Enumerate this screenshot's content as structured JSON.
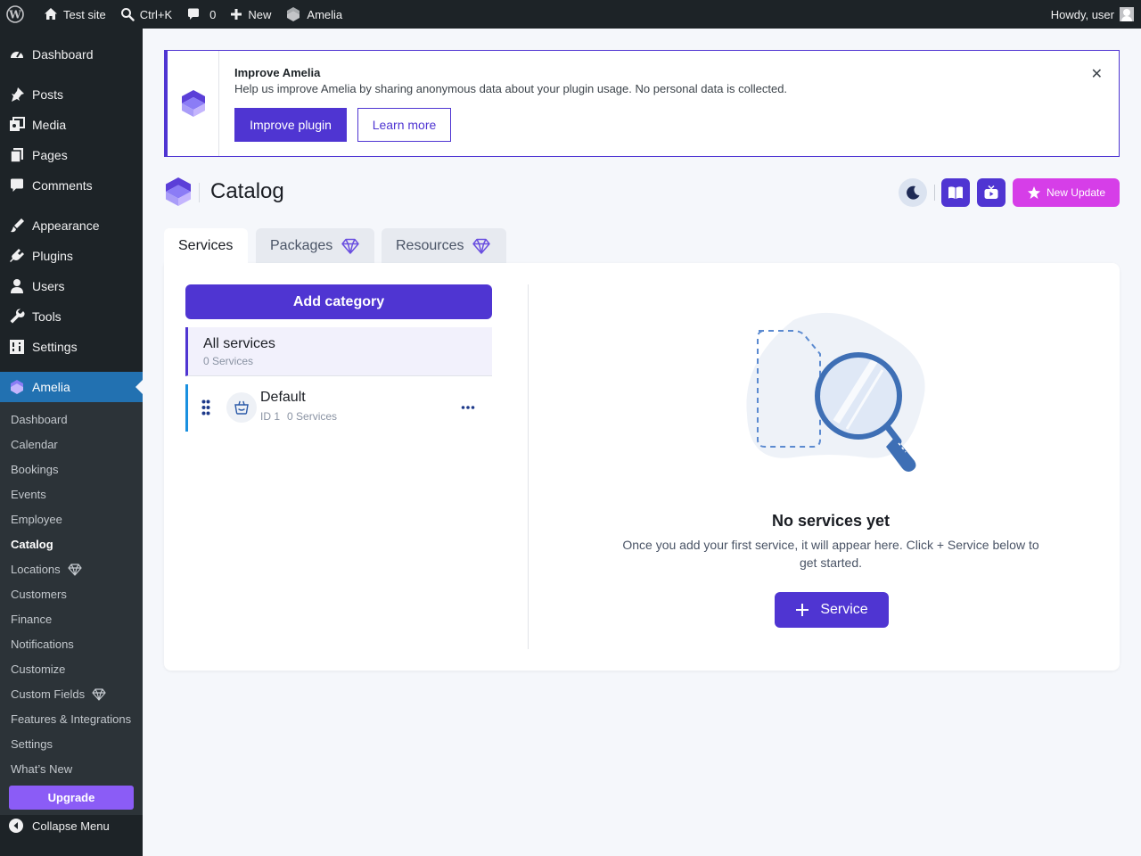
{
  "adminbar": {
    "site_name": "Test site",
    "search_shortcut": "Ctrl+K",
    "comments_count": "0",
    "new_label": "New",
    "plugin_label": "Amelia",
    "greeting": "Howdy, user"
  },
  "sidebar": {
    "menu": [
      {
        "label": "Dashboard",
        "icon": "dashboard-icon"
      },
      {
        "label": "Posts",
        "icon": "pin-icon"
      },
      {
        "label": "Media",
        "icon": "media-icon"
      },
      {
        "label": "Pages",
        "icon": "pages-icon"
      },
      {
        "label": "Comments",
        "icon": "comment-icon"
      },
      {
        "label": "Appearance",
        "icon": "brush-icon"
      },
      {
        "label": "Plugins",
        "icon": "plug-icon"
      },
      {
        "label": "Users",
        "icon": "user-icon"
      },
      {
        "label": "Tools",
        "icon": "wrench-icon"
      },
      {
        "label": "Settings",
        "icon": "settings-icon"
      },
      {
        "label": "Amelia",
        "icon": "amelia-logo-icon"
      }
    ],
    "submenu": [
      {
        "label": "Dashboard"
      },
      {
        "label": "Calendar"
      },
      {
        "label": "Bookings"
      },
      {
        "label": "Events"
      },
      {
        "label": "Employee"
      },
      {
        "label": "Catalog",
        "current": true
      },
      {
        "label": "Locations",
        "premium": true
      },
      {
        "label": "Customers"
      },
      {
        "label": "Finance"
      },
      {
        "label": "Notifications"
      },
      {
        "label": "Customize"
      },
      {
        "label": "Custom Fields",
        "premium": true
      },
      {
        "label": "Features & Integrations"
      },
      {
        "label": "Settings"
      },
      {
        "label": "What’s New"
      }
    ],
    "upgrade_label": "Upgrade",
    "collapse_label": "Collapse Menu"
  },
  "notice": {
    "title": "Improve Amelia",
    "text": "Help us improve Amelia by sharing anonymous data about your plugin usage. No personal data is collected.",
    "primary_button": "Improve plugin",
    "secondary_button": "Learn more"
  },
  "page": {
    "title": "Catalog",
    "new_update_label": "New Update"
  },
  "tabs": [
    {
      "label": "Services",
      "active": true
    },
    {
      "label": "Packages",
      "premium": true
    },
    {
      "label": "Resources",
      "premium": true
    }
  ],
  "categories": {
    "add_label": "Add category",
    "all_services": {
      "label": "All services",
      "count": "0 Services"
    },
    "items": [
      {
        "name": "Default",
        "id": "ID 1",
        "count": "0 Services"
      }
    ]
  },
  "empty_state": {
    "title": "No services yet",
    "text": "Once you add your first service, it will appear here. Click + Service below to get started.",
    "button_label": "Service"
  },
  "colors": {
    "accent": "#4f35d2",
    "wp_admin_dark": "#1d2327",
    "wp_active_blue": "#2271b1",
    "new_update_pink": "#d63ee8",
    "upgrade_purple": "#8b5cf6"
  }
}
